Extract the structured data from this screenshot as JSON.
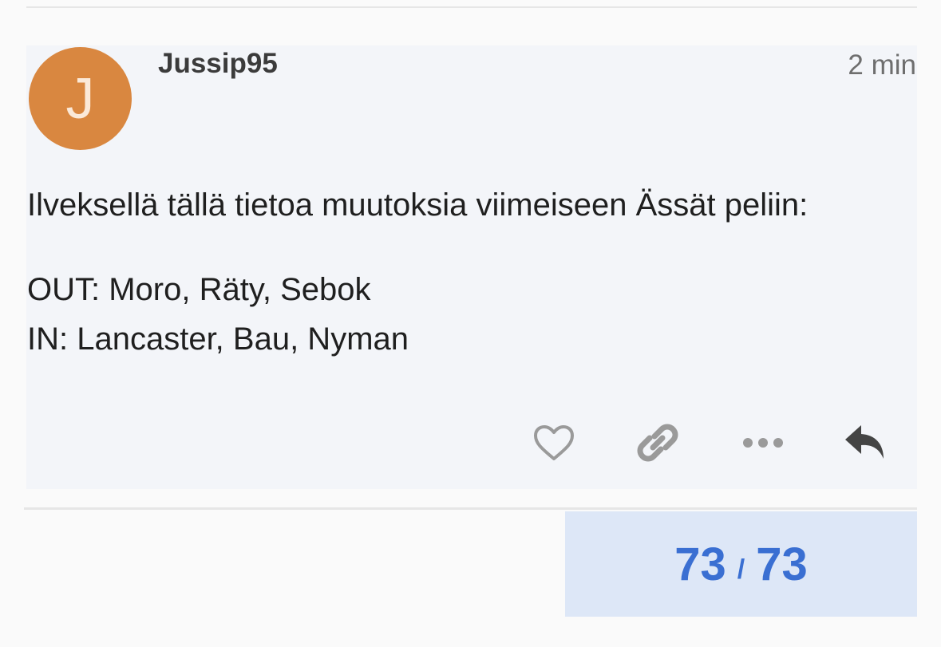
{
  "post": {
    "author": "Jussip95",
    "avatar_letter": "J",
    "time": "2 min",
    "lines": [
      "Ilveksellä tällä tietoa muutoksia viimeiseen Ässät peliin:",
      "OUT: Moro, Räty, Sebok",
      "IN: Lancaster, Bau, Nyman"
    ]
  },
  "actions": {
    "icons": [
      "heart-icon",
      "link-icon",
      "more-icon",
      "reply-icon"
    ]
  },
  "progress": {
    "current": "73",
    "separator": "/",
    "total": "73"
  },
  "colors": {
    "avatar": "#d98740",
    "accent": "#3a6fd2",
    "post_bg": "#f3f5f9",
    "progress_bg": "#dde7f7"
  }
}
